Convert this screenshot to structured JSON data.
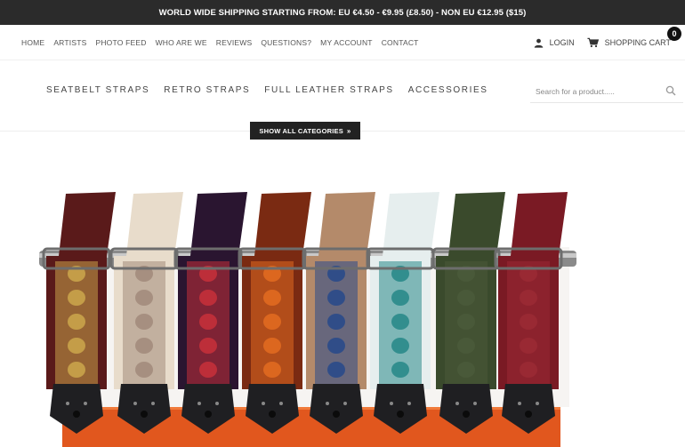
{
  "announcement": "WORLD WIDE SHIPPING STARTING FROM: EU €4.50 - €9.95 (£8.50) - NON EU €12.95 ($15)",
  "main_nav": [
    "HOME",
    "ARTISTS",
    "PHOTO FEED",
    "WHO ARE WE",
    "REVIEWS",
    "QUESTIONS?",
    "MY ACCOUNT",
    "CONTACT"
  ],
  "user_actions": {
    "login_label": "LOGIN",
    "login_icon": "person-icon",
    "cart_label": "SHOPPING CART",
    "cart_icon": "cart-icon",
    "cart_count": "0"
  },
  "category_nav": [
    "SEATBELT STRAPS",
    "RETRO STRAPS",
    "FULL LEATHER STRAPS",
    "ACCESSORIES"
  ],
  "search": {
    "placeholder": "Search for a product.....",
    "icon": "search-icon"
  },
  "show_all_button": {
    "label": "SHOW ALL CATEGORIES",
    "icon": "double-chevron-down-icon"
  },
  "hero": {
    "image": "guitar-straps-display",
    "strap_colors": [
      "#5a1a1a",
      "#e8dccb",
      "#2a1530",
      "#7a2a12",
      "#b48a6a",
      "#e6eeee",
      "#3a4a2c",
      "#7a1a24"
    ],
    "accent_colors": [
      "#c9a34a",
      "#a38c7c",
      "#c4303a",
      "#e06a20",
      "#2a4a8a",
      "#2a8a8a",
      "#4a5a3a",
      "#9a2a34"
    ]
  }
}
